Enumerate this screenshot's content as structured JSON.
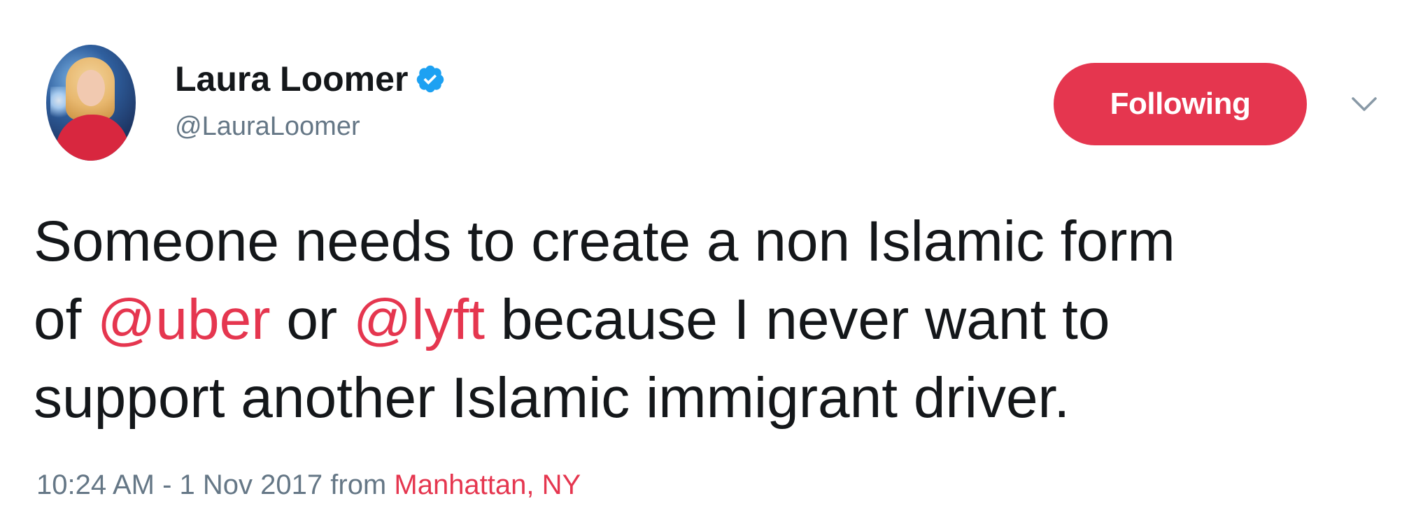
{
  "author": {
    "display_name": "Laura Loomer",
    "handle": "@LauraLoomer",
    "verified": true,
    "verified_icon": "verified-badge-icon"
  },
  "follow_button": {
    "label": "Following",
    "color": "#e5364f"
  },
  "menu": {
    "icon": "chevron-down-icon"
  },
  "tweet": {
    "line1": "Someone needs to create a non Islamic form",
    "line2_pre": "of ",
    "mention1": "@uber",
    "line2_mid": " or ",
    "mention2": "@lyft",
    "line2_post": " because I never want to",
    "line3": "support another Islamic immigrant driver."
  },
  "meta": {
    "timestamp": "10:24 AM - 1 Nov 2017",
    "from_label": " from ",
    "location": "Manhattan, NY"
  },
  "colors": {
    "accent": "#e5364f",
    "text": "#14171a",
    "secondary": "#657786",
    "verified": "#1da1f2"
  }
}
